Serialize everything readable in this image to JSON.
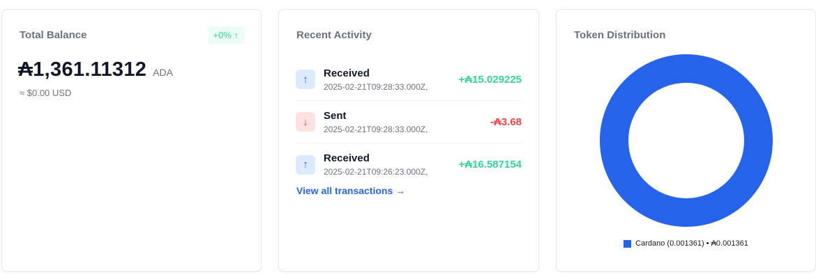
{
  "balance_card": {
    "title": "Total Balance",
    "change_badge": "+0% ↑",
    "amount": "₳1,361.11312",
    "unit": "ADA",
    "usd_value": "≈ $0.00 USD"
  },
  "activity_card": {
    "title": "Recent Activity",
    "transactions": [
      {
        "type": "Received",
        "direction": "in",
        "time": "2025-02-21T09:28:33.000Z,",
        "amount": "+₳15.029225",
        "icon": "arrow-up-icon"
      },
      {
        "type": "Sent",
        "direction": "out",
        "time": "2025-02-21T09:28:33.000Z,",
        "amount": "-₳3.68",
        "icon": "arrow-down-icon"
      },
      {
        "type": "Received",
        "direction": "in",
        "time": "2025-02-21T09:26:23.000Z,",
        "amount": "+₳16.587154",
        "icon": "arrow-up-icon"
      }
    ],
    "view_all_label": "View all transactions →"
  },
  "tokens_card": {
    "title": "Token Distribution",
    "legend_label": "Cardano (0.001361) • ₳0.001361"
  },
  "chart_data": {
    "type": "pie",
    "categories": [
      "Cardano"
    ],
    "values": [
      0.001361
    ],
    "colors": [
      "#2563eb"
    ],
    "legend_placement": "bottom"
  },
  "colors": {
    "accent": "#2563eb",
    "positive": "#34d399",
    "negative": "#ef4444"
  }
}
